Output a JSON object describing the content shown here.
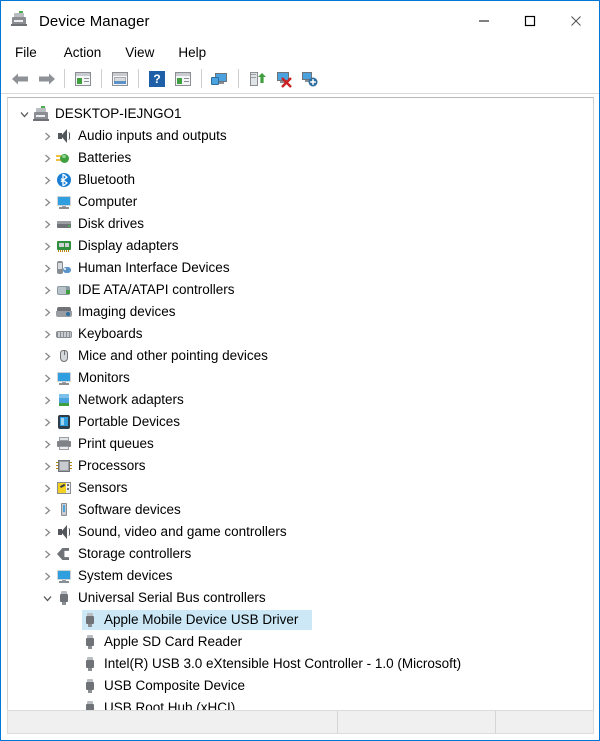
{
  "window": {
    "title": "Device Manager",
    "icon": "device-manager-icon",
    "accent_border": "#0078d7",
    "controls": {
      "minimize": "Minimize",
      "maximize": "Maximize",
      "close": "Close"
    }
  },
  "menubar": {
    "items": [
      {
        "label": "File",
        "name": "menu-file"
      },
      {
        "label": "Action",
        "name": "menu-action"
      },
      {
        "label": "View",
        "name": "menu-view"
      },
      {
        "label": "Help",
        "name": "menu-help"
      }
    ]
  },
  "toolbar": {
    "buttons": [
      {
        "name": "back-button",
        "icon": "left-arrow-icon",
        "label": "Back"
      },
      {
        "name": "forward-button",
        "icon": "right-arrow-icon",
        "label": "Forward"
      },
      {
        "name": "show-hide-console-tree-button",
        "icon": "console-tree-icon",
        "label": "Show/Hide Console Tree"
      },
      {
        "name": "properties-button",
        "icon": "properties-icon",
        "label": "Properties"
      },
      {
        "name": "help-button",
        "icon": "help-icon",
        "label": "Help"
      },
      {
        "name": "show-hide-action-pane-button",
        "icon": "action-pane-icon",
        "label": "Show/Hide Action Pane"
      },
      {
        "name": "scan-for-hardware-changes-button",
        "icon": "scan-hardware-icon",
        "label": "Scan for hardware changes"
      },
      {
        "name": "update-driver-button",
        "icon": "update-driver-icon",
        "label": "Update Driver Software"
      },
      {
        "name": "uninstall-device-button",
        "icon": "uninstall-device-icon",
        "label": "Uninstall device"
      },
      {
        "name": "add-legacy-hardware-button",
        "icon": "add-hardware-icon",
        "label": "Add legacy hardware"
      }
    ]
  },
  "tree": {
    "root": {
      "label": "DESKTOP-IEJNGO1",
      "icon": "computer-tower-icon",
      "expanded": true,
      "name": "tree-item-desktop-iejngo1"
    },
    "categories": [
      {
        "label": "Audio inputs and outputs",
        "icon": "speaker-icon",
        "icon_class": "ic-speaker",
        "expanded": false,
        "name": "tree-item-audio-inputs-and-outputs"
      },
      {
        "label": "Batteries",
        "icon": "battery-icon",
        "icon_class": "ic-battery",
        "expanded": false,
        "name": "tree-item-batteries"
      },
      {
        "label": "Bluetooth",
        "icon": "bluetooth-icon",
        "icon_class": "ic-bluetooth",
        "expanded": false,
        "name": "tree-item-bluetooth"
      },
      {
        "label": "Computer",
        "icon": "computer-icon",
        "icon_class": "ic-monitor",
        "expanded": false,
        "name": "tree-item-computer"
      },
      {
        "label": "Disk drives",
        "icon": "disk-drive-icon",
        "icon_class": "ic-disk",
        "expanded": false,
        "name": "tree-item-disk-drives"
      },
      {
        "label": "Display adapters",
        "icon": "display-adapter-icon",
        "icon_class": "ic-display",
        "expanded": false,
        "name": "tree-item-display-adapters"
      },
      {
        "label": "Human Interface Devices",
        "icon": "hid-icon",
        "icon_class": "ic-hid",
        "expanded": false,
        "name": "tree-item-human-interface-devices"
      },
      {
        "label": "IDE ATA/ATAPI controllers",
        "icon": "ide-controller-icon",
        "icon_class": "ic-ide",
        "expanded": false,
        "name": "tree-item-ide-ata-atapi-controllers"
      },
      {
        "label": "Imaging devices",
        "icon": "scanner-icon",
        "icon_class": "ic-imaging",
        "expanded": false,
        "name": "tree-item-imaging-devices"
      },
      {
        "label": "Keyboards",
        "icon": "keyboard-icon",
        "icon_class": "ic-keyboard",
        "expanded": false,
        "name": "tree-item-keyboards"
      },
      {
        "label": "Mice and other pointing devices",
        "icon": "mouse-icon",
        "icon_class": "ic-mouse",
        "expanded": false,
        "name": "tree-item-mice-and-other-pointing-devices"
      },
      {
        "label": "Monitors",
        "icon": "monitor-icon",
        "icon_class": "ic-monitor",
        "expanded": false,
        "name": "tree-item-monitors"
      },
      {
        "label": "Network adapters",
        "icon": "network-adapter-icon",
        "icon_class": "ic-network",
        "expanded": false,
        "name": "tree-item-network-adapters"
      },
      {
        "label": "Portable Devices",
        "icon": "portable-device-icon",
        "icon_class": "ic-portable",
        "expanded": false,
        "name": "tree-item-portable-devices"
      },
      {
        "label": "Print queues",
        "icon": "printer-icon",
        "icon_class": "ic-printer",
        "expanded": false,
        "name": "tree-item-print-queues"
      },
      {
        "label": "Processors",
        "icon": "processor-icon",
        "icon_class": "ic-processor",
        "expanded": false,
        "name": "tree-item-processors"
      },
      {
        "label": "Sensors",
        "icon": "sensor-icon",
        "icon_class": "ic-sensor",
        "expanded": false,
        "name": "tree-item-sensors"
      },
      {
        "label": "Software devices",
        "icon": "software-device-icon",
        "icon_class": "ic-software",
        "expanded": false,
        "name": "tree-item-software-devices"
      },
      {
        "label": "Sound, video and game controllers",
        "icon": "speaker-icon",
        "icon_class": "ic-speaker",
        "expanded": false,
        "name": "tree-item-sound-video-and-game-controllers"
      },
      {
        "label": "Storage controllers",
        "icon": "storage-controller-icon",
        "icon_class": "ic-storage",
        "expanded": false,
        "name": "tree-item-storage-controllers"
      },
      {
        "label": "System devices",
        "icon": "system-device-icon",
        "icon_class": "ic-monitor",
        "expanded": false,
        "name": "tree-item-system-devices"
      },
      {
        "label": "Universal Serial Bus controllers",
        "icon": "usb-icon",
        "icon_class": "ic-usb",
        "expanded": true,
        "name": "tree-item-universal-serial-bus-controllers"
      }
    ],
    "usb_children": [
      {
        "label": "Apple Mobile Device USB Driver",
        "icon": "usb-icon",
        "selected": true,
        "name": "tree-item-apple-mobile-device-usb-driver"
      },
      {
        "label": "Apple SD Card Reader",
        "icon": "usb-icon",
        "selected": false,
        "name": "tree-item-apple-sd-card-reader"
      },
      {
        "label": "Intel(R) USB 3.0 eXtensible Host Controller - 1.0 (Microsoft)",
        "icon": "usb-icon",
        "selected": false,
        "name": "tree-item-intel-usb-30-extensible-host-controller"
      },
      {
        "label": "USB Composite Device",
        "icon": "usb-icon",
        "selected": false,
        "name": "tree-item-usb-composite-device"
      },
      {
        "label": "USB Root Hub (xHCI)",
        "icon": "usb-icon",
        "selected": false,
        "name": "tree-item-usb-root-hub-xhci"
      }
    ],
    "selection_color": "#cce8f6",
    "expanded_glyph": "v",
    "collapsed_glyph": ">"
  },
  "statusbar": {
    "pane1": "",
    "pane2": "",
    "pane3": ""
  }
}
